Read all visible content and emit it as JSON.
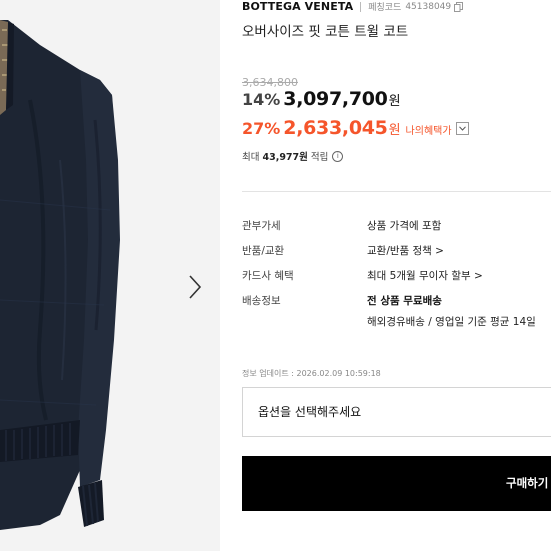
{
  "product": {
    "brand": "BOTTEGA VENETA",
    "code_label": "페칭코드",
    "code_value": "45138049",
    "title": "오버사이즈 핏 코튼 트윌 코트"
  },
  "pricing": {
    "original_price": "3,634,800",
    "discount_rate": "14%",
    "sale_price": "3,097,700",
    "currency_suffix": "원",
    "member_discount_rate": "27%",
    "member_price": "2,633,045",
    "member_currency_suffix": "원",
    "my_benefit_label": "나의혜택가",
    "accent_color": "#f5552b"
  },
  "points": {
    "prefix": "최대",
    "amount": "43,977원",
    "suffix": "적립",
    "info_glyph": "i"
  },
  "details": [
    {
      "label": "관부가세",
      "value": "상품 가격에 포함"
    },
    {
      "label": "반품/교환",
      "value": "교환/반품 정책 >"
    },
    {
      "label": "카드사 혜택",
      "value": "최대 5개월 무이자 할부 >"
    },
    {
      "label": "배송정보",
      "value": "전 상품 무료배송",
      "value2": "해외경유배송 / 영업일 기준 평균 14일"
    }
  ],
  "updated_text": "정보 업데이트 : 2026.02.09 10:59:18",
  "option_placeholder": "옵션을 선택해주세요",
  "buy_label": "구매하기",
  "icons": {
    "copy": "copy-icon",
    "next": "chevron-right-icon",
    "toggle": "chevron-down-icon",
    "info": "info-icon"
  }
}
